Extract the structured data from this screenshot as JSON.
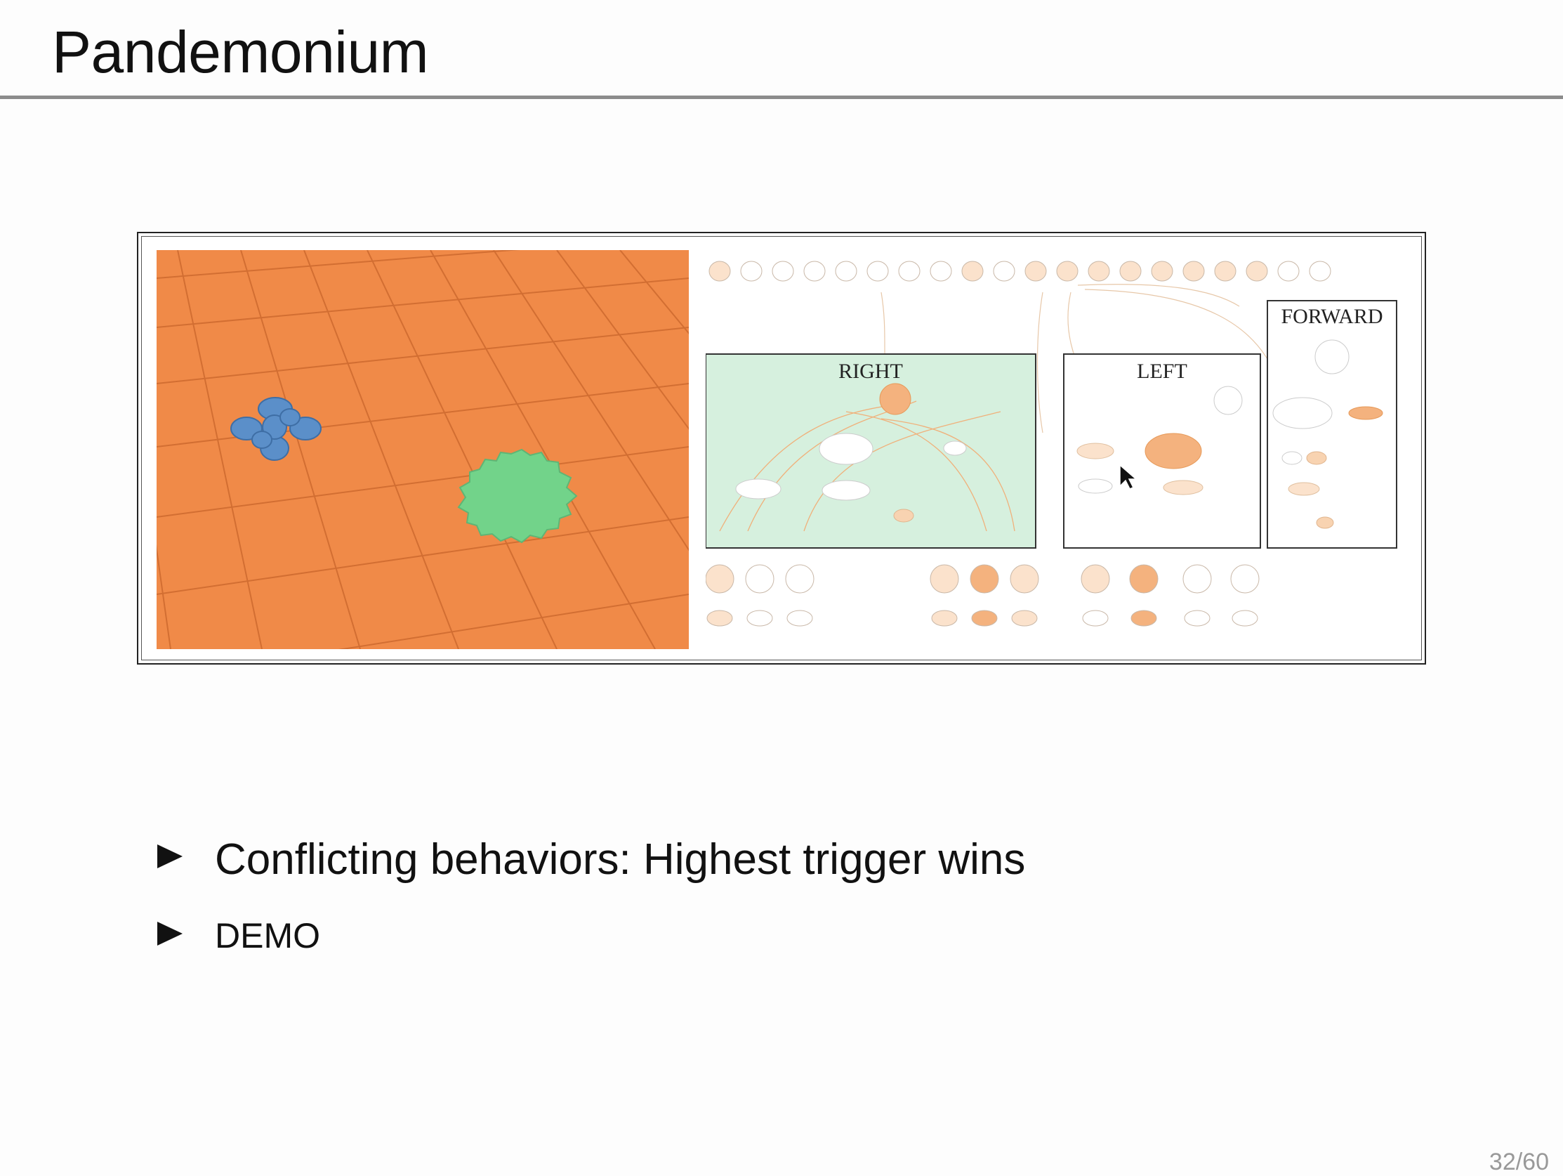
{
  "slide": {
    "title": "Pandemonium",
    "page_number": "32/60"
  },
  "figure": {
    "diagram_labels": {
      "right": "RIGHT",
      "left": "LEFT",
      "forward": "FORWARD"
    }
  },
  "bullets": [
    {
      "text": "Conflicting behaviors: Highest trigger wins"
    },
    {
      "text": "DEMO"
    }
  ],
  "colors": {
    "floor": "#f08a48",
    "robot": "#5b8fc9",
    "target": "#72d38a",
    "right_panel": "#d6f0de",
    "node_orange": "#f4b27e",
    "node_light": "#fbe2cc"
  }
}
